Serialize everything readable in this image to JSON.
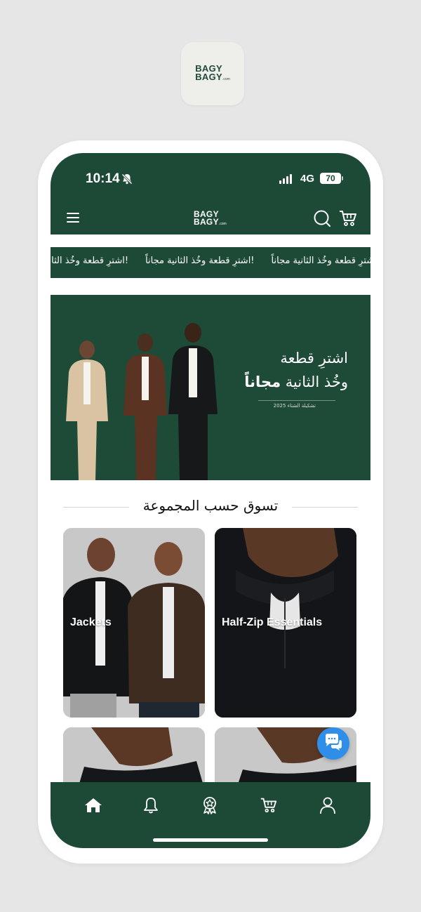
{
  "app_icon": {
    "logo_line1": "BAGY",
    "logo_line2": "BAGY",
    "logo_suffix": ".com"
  },
  "status_bar": {
    "time": "10:14",
    "network": "4G",
    "battery": "70"
  },
  "header": {
    "logo_line1": "BAGY",
    "logo_line2": "BAGY",
    "logo_suffix": ".com",
    "icons": [
      "menu-icon",
      "search-icon",
      "cart-icon"
    ]
  },
  "announcement": {
    "items": [
      "!اشترِ قطعة وخُذ الثانية مجاناً",
      "!اشترِ قطعة وخُذ الثانية مجاناً",
      "!اشترِ قطعة وخُذ الثانية مجاناً"
    ]
  },
  "hero": {
    "title_line1": "اشترِ قطعة",
    "title_line2_plain": "وخُذ الثانية",
    "title_line2_bold": "مجاناً",
    "subtitle": "تشكيلة الشتاء 2025"
  },
  "section": {
    "title": "تسوق حسب المجموعة"
  },
  "categories": [
    {
      "label": "Jackets"
    },
    {
      "label": "Half-Zip Essentials"
    },
    {
      "label": ""
    },
    {
      "label": ""
    }
  ],
  "bottom_nav": {
    "items": [
      "home-icon",
      "bell-icon",
      "badge-icon",
      "cart-icon",
      "profile-icon"
    ]
  },
  "colors": {
    "brand_green": "#1d4a37",
    "chat_blue": "#2f8fe8",
    "background": "#e6e6e6"
  }
}
